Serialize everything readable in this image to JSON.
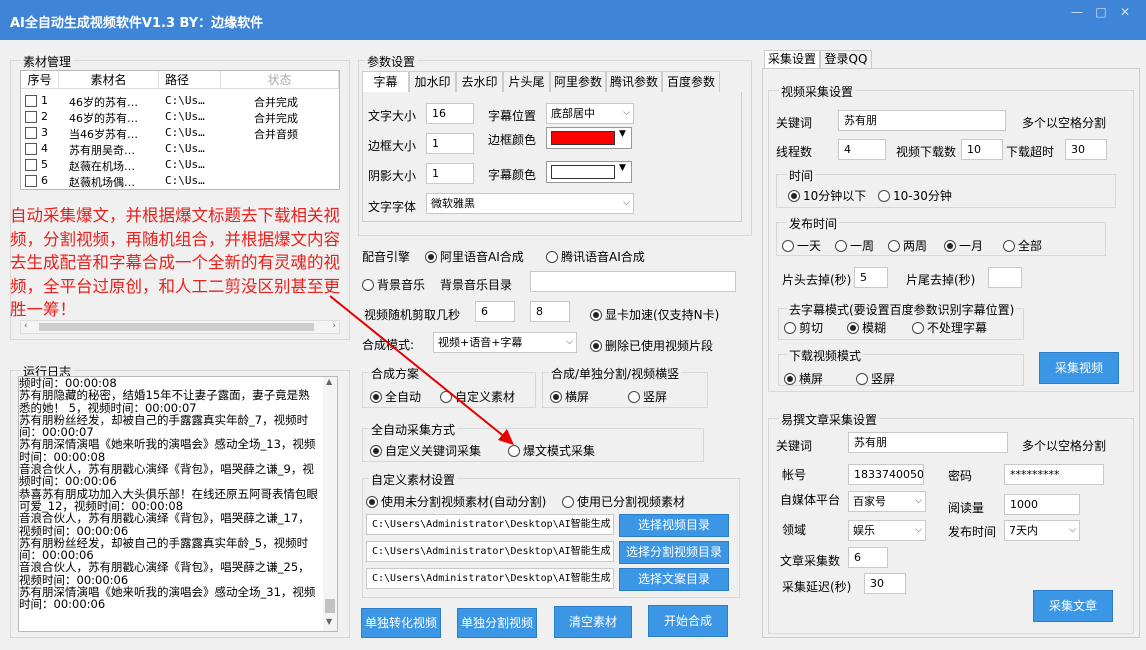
{
  "window": {
    "title": "AI全自动生成视频软件V1.3 BY：边缘软件",
    "min": "—",
    "max": "□",
    "close": "✕"
  },
  "material": {
    "title": "素材管理",
    "headers": [
      "序号",
      "素材名",
      "路径",
      "状态"
    ],
    "rows": [
      {
        "no": "1",
        "name": "46岁的苏有…",
        "path": "C:\\Us…",
        "status": "合并完成"
      },
      {
        "no": "2",
        "name": "46岁的苏有…",
        "path": "C:\\Us…",
        "status": "合并完成"
      },
      {
        "no": "3",
        "name": "当46岁苏有…",
        "path": "C:\\Us…",
        "status": "合并音频"
      },
      {
        "no": "4",
        "name": "苏有朋吴奇…",
        "path": "C:\\Us…",
        "status": ""
      },
      {
        "no": "5",
        "name": "赵薇在机场…",
        "path": "C:\\Us…",
        "status": ""
      },
      {
        "no": "6",
        "name": "赵薇机场偶…",
        "path": "C:\\Us…",
        "status": ""
      }
    ]
  },
  "overlay_text": "自动采集爆文，并根据爆文标题去下载相关视频，分割视频，再随机组合，并根据爆文内容去生成配音和字幕合成一个全新的有灵魂的视频，全平台过原创，和人工二剪没区别甚至更胜一筹！",
  "log": {
    "title": "运行日志",
    "text": "频时间：00:00:08\n苏有朋隐藏的秘密，结婚15年不让妻子露面，妻子竟是熟悉的她！ 5，视频时间：00:00:07\n苏有朋粉丝经发，却被自己的手露露真实年龄_7，视频时间：00:00:07\n苏有朋深情演唱《她来听我的演唱会》感动全场_13，视频时间：00:00:08\n音浪合伙人，苏有朋戳心演绎《背包》，唱哭薛之谦_9，视频时间：00:00:06\n恭喜苏有朋成功加入大头俱乐部！在线还原五阿哥表情包眼可爱_12，视频时间：00:00:08\n音浪合伙人，苏有朋戳心演绎《背包》，唱哭薛之谦_17，视频时间：00:00:06\n苏有朋粉丝经发，却被自己的手露露真实年龄_5，视频时间：00:00:06\n音浪合伙人，苏有朋戳心演绎《背包》，唱哭薛之谦_25，视频时间：00:00:06\n苏有朋深情演唱《她来听我的演唱会》感动全场_31，视频时间：00:00:06"
  },
  "params": {
    "title": "参数设置",
    "tabs": [
      "字幕",
      "加水印",
      "去水印",
      "片头尾",
      "阿里参数",
      "腾讯参数",
      "百度参数"
    ],
    "font_size_label": "文字大小",
    "font_size": "16",
    "pos_label": "字幕位置",
    "pos_value": "底部居中",
    "border_label": "边框大小",
    "border": "1",
    "border_color_label": "边框颜色",
    "shadow_label": "阴影大小",
    "shadow": "1",
    "sub_color_label": "字幕颜色",
    "font_label": "文字字体",
    "font_value": "微软雅黑"
  },
  "dub": {
    "label": "配音引擎",
    "ali": "阿里语音AI合成",
    "tx": "腾讯语音AI合成",
    "bgm": "背景音乐",
    "bgm_dir": "背景音乐目录",
    "cut_label": "视频随机剪取几秒",
    "cut_a": "6",
    "cut_b": "8",
    "gpu": "显卡加速(仅支持N卡)",
    "mode_label": "合成模式:",
    "mode_value": "视频+语音+字幕",
    "delete": "删除已使用视频片段"
  },
  "scheme": {
    "title": "合成方案",
    "auto": "全自动",
    "custom": "自定义素材"
  },
  "orient": {
    "title": "合成/单独分割/视频横竖",
    "h": "横屏",
    "v": "竖屏"
  },
  "collect_mode": {
    "title": "全自动采集方式",
    "kw": "自定义关键词采集",
    "hot": "爆文模式采集"
  },
  "custom_mat": {
    "title": "自定义素材设置",
    "opt1": "使用未分割视频素材(自动分割)",
    "opt2": "使用已分割视频素材",
    "p1": "C:\\Users\\Administrator\\Desktop\\AI智能生成",
    "b1": "选择视频目录",
    "p2": "C:\\Users\\Administrator\\Desktop\\AI智能生成",
    "b2": "选择分割视频目录",
    "p3": "C:\\Users\\Administrator\\Desktop\\AI智能生成",
    "b3": "选择文案目录"
  },
  "bottom": {
    "b1": "单独转化视频",
    "b2": "单独分割视频",
    "b3": "清空素材",
    "b4": "开始合成"
  },
  "right": {
    "tabs": [
      "采集设置",
      "登录QQ"
    ],
    "video": {
      "title": "视频采集设置",
      "kw_label": "关键词",
      "kw": "苏有朋",
      "kw_hint": "多个以空格分割",
      "threads_label": "线程数",
      "threads": "4",
      "dl_label": "视频下载数",
      "dl": "10",
      "timeout_label": "下载超时",
      "timeout": "30",
      "time_title": "时间",
      "t1": "10分钟以下",
      "t2": "10-30分钟",
      "pub_title": "发布时间",
      "p1": "一天",
      "p2": "一周",
      "p3": "两周",
      "p4": "一月",
      "p5": "全部",
      "head_label": "片头去掉(秒)",
      "head": "5",
      "tail_label": "片尾去掉(秒)",
      "tail": "",
      "sub_title": "去字幕模式(要设置百度参数识别字幕位置)",
      "s1": "剪切",
      "s2": "模糊",
      "s3": "不处理字幕",
      "dlmode_title": "下载视频模式",
      "d1": "横屏",
      "d2": "竖屏",
      "btn": "采集视频"
    },
    "article": {
      "title": "易撰文章采集设置",
      "kw_label": "关键词",
      "kw": "苏有朋",
      "kw_hint": "多个以空格分割",
      "acc_label": "帐号",
      "acc": "18337400500",
      "pwd_label": "密码",
      "pwd": "*********",
      "plat_label": "自媒体平台",
      "plat": "百家号",
      "read_label": "阅读量",
      "read": "1000",
      "field_label": "领域",
      "field": "娱乐",
      "pubt_label": "发布时间",
      "pubt": "7天内",
      "count_label": "文章采集数",
      "count": "6",
      "delay_label": "采集延迟(秒)",
      "delay": "30",
      "btn": "采集文章"
    }
  }
}
